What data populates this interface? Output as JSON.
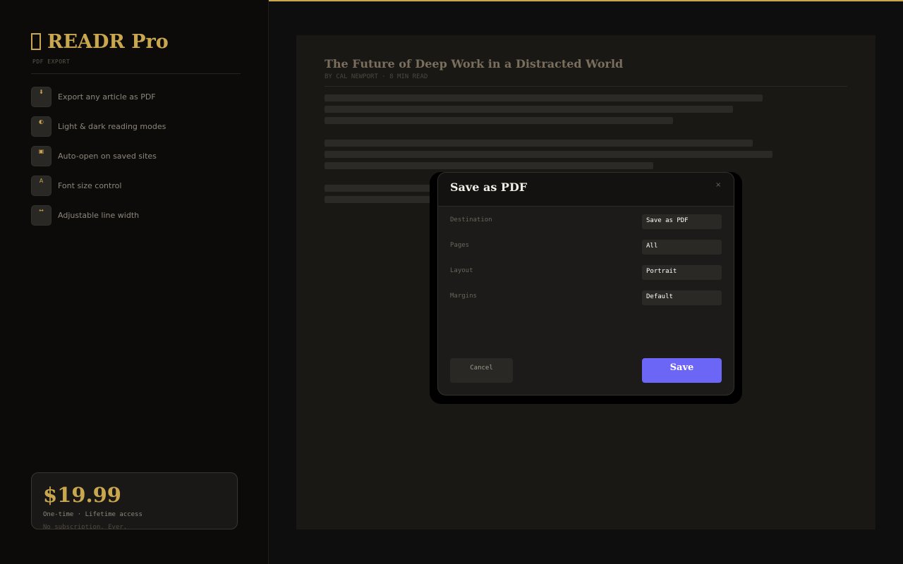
{
  "brand": {
    "name": "READR Pro",
    "subtitle": "PDF EXPORT"
  },
  "features": [
    {
      "icon": "download-icon",
      "glyph": "⬇",
      "label": "Export any article as PDF"
    },
    {
      "icon": "theme-icon",
      "glyph": "◐",
      "label": "Light & dark reading modes"
    },
    {
      "icon": "bookmark-icon",
      "glyph": "▣",
      "label": "Auto-open on saved sites"
    },
    {
      "icon": "font-icon",
      "glyph": "A",
      "label": "Font size control"
    },
    {
      "icon": "width-icon",
      "glyph": "↔",
      "label": "Adjustable line width"
    }
  ],
  "pricing": {
    "price": "$19.99",
    "note": "One-time · Lifetime access",
    "note2": "No subscription. Ever."
  },
  "article": {
    "title": "The Future of Deep Work in a Distracted World",
    "meta": "BY CAL NEWPORT  ·  8 MIN READ"
  },
  "dialog": {
    "title": "Save as PDF",
    "close": "×",
    "fields": [
      {
        "label": "Destination",
        "value": "Save as PDF"
      },
      {
        "label": "Pages",
        "value": "All"
      },
      {
        "label": "Layout",
        "value": "Portrait"
      },
      {
        "label": "Margins",
        "value": "Default"
      }
    ],
    "cancel_label": "Cancel",
    "save_label": "Save"
  },
  "colors": {
    "accent": "#c9a74f",
    "primary_button": "#6b66f5",
    "background": "#0e0e0e"
  }
}
